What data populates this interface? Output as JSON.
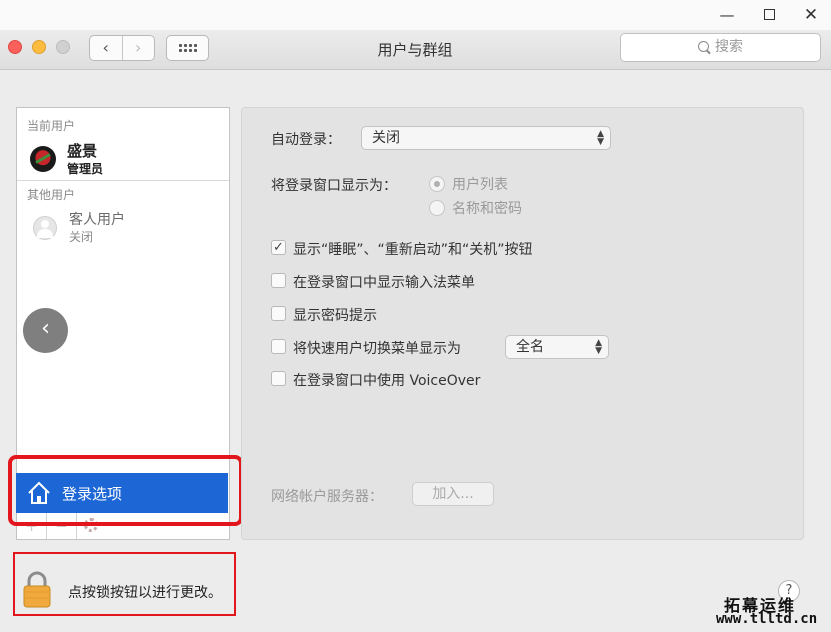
{
  "window_controls": {
    "minimize": "—",
    "maximize": "",
    "close": "✕"
  },
  "toolbar": {
    "title": "用户与群组",
    "back_glyph": "‹",
    "forward_glyph": "›",
    "search_placeholder": "搜索"
  },
  "sidebar": {
    "current_users_header": "当前用户",
    "current_user": {
      "name": "盛景",
      "role": "管理员"
    },
    "other_users_header": "其他用户",
    "guest_user": {
      "name": "客人用户",
      "status": "关闭"
    },
    "login_options_label": "登录选项",
    "add_glyph": "+",
    "remove_glyph": "−"
  },
  "back_overlay_glyph": "‹",
  "panel": {
    "auto_login_label": "自动登录：",
    "auto_login_value": "关闭",
    "display_login_window_label": "将登录窗口显示为：",
    "radio_options": [
      "用户列表",
      "名称和密码"
    ],
    "radio_selected": "用户列表",
    "checkboxes": [
      {
        "label": "显示“睡眠”、“重新启动”和“关机”按钮",
        "checked": true
      },
      {
        "label": "在登录窗口中显示输入法菜单",
        "checked": false
      },
      {
        "label": "显示密码提示",
        "checked": false
      },
      {
        "label": "将快速用户切换菜单显示为",
        "checked": false
      },
      {
        "label": "在登录窗口中使用 VoiceOver",
        "checked": false
      }
    ],
    "fast_switch_value": "全名",
    "network_server_label": "网络帐户服务器：",
    "join_button": "加入..."
  },
  "footer": {
    "lock_text": "点按锁按钮以进行更改。",
    "help_glyph": "?"
  },
  "watermark": {
    "line1": "拓幕运维",
    "line2": "www.tlltd.cn"
  },
  "colors": {
    "selection": "#1d66d6",
    "highlight_box": "#e2161c"
  }
}
